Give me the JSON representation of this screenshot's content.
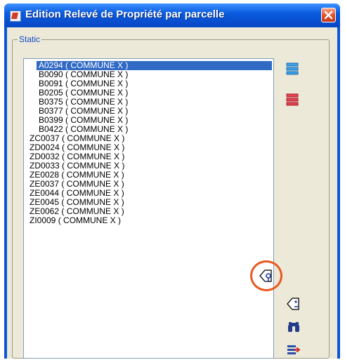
{
  "window": {
    "title": "Edition Relevé de Propriété par parcelle"
  },
  "group": {
    "label": "Static"
  },
  "list": {
    "items": [
      "A0294 ( COMMUNE X )",
      "B0090 ( COMMUNE X )",
      "B0091 ( COMMUNE X )",
      "B0205 ( COMMUNE X )",
      "B0375 ( COMMUNE X )",
      "B0377 ( COMMUNE X )",
      "B0399 ( COMMUNE X )",
      "B0422 ( COMMUNE X )",
      "ZC0037 ( COMMUNE X )",
      "ZD0024 ( COMMUNE X )",
      "ZD0032 ( COMMUNE X )",
      "ZD0033 ( COMMUNE X )",
      "ZE0028 ( COMMUNE X )",
      "ZE0037 ( COMMUNE X )",
      "ZE0044 ( COMMUNE X )",
      "ZE0045 ( COMMUNE X )",
      "ZE0062 ( COMMUNE X )",
      "ZI0009 ( COMMUNE X )"
    ],
    "selected_index": 0
  },
  "buttons": [
    {
      "name": "select-all-button",
      "icon": "list-select-all-icon"
    },
    {
      "name": "deselect-all-button",
      "icon": "list-deselect-all-icon"
    },
    {
      "name": "edit-parcel-button",
      "icon": "tag-edit-icon"
    },
    {
      "name": "tag-button",
      "icon": "tag-icon"
    },
    {
      "name": "search-button",
      "icon": "binoculars-icon"
    },
    {
      "name": "export-button",
      "icon": "export-arrow-icon"
    }
  ],
  "colors": {
    "titlebar": "#0a56d8",
    "selection": "#316ac5",
    "highlight": "#e85a24",
    "close": "#e2502a"
  }
}
